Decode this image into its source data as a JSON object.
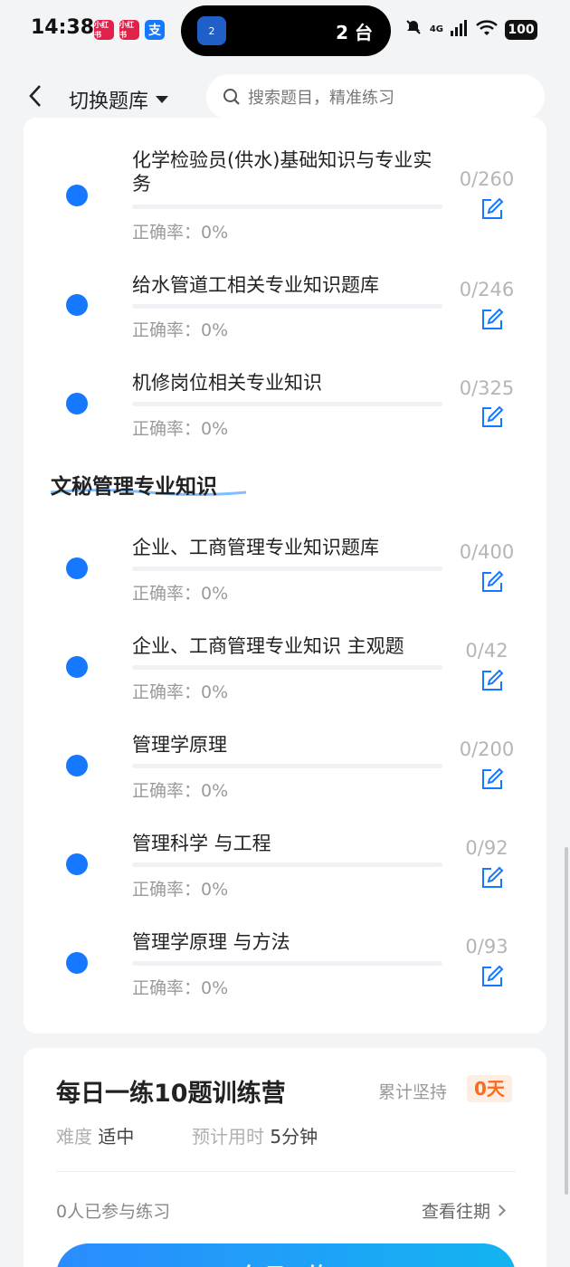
{
  "status_bar": {
    "time": "14:38",
    "app_badges": [
      "小红书",
      "小红书",
      "支"
    ],
    "island": {
      "icon_text": "2",
      "text": "2 台"
    },
    "network": "4G",
    "battery": "100"
  },
  "header": {
    "switch_label": "切换题库",
    "search_placeholder": "搜索题目，精准练习"
  },
  "bank_list": {
    "accuracy_prefix": "正确率：",
    "items_top": [
      {
        "title": "化学检验员(供水)基础知识与专业实务",
        "count": "0/260",
        "accuracy": "0%"
      },
      {
        "title": "给水管道工相关专业知识题库",
        "count": "0/246",
        "accuracy": "0%"
      },
      {
        "title": "机修岗位相关专业知识",
        "count": "0/325",
        "accuracy": "0%"
      }
    ],
    "section_title": "文秘管理专业知识",
    "items_section": [
      {
        "title": "企业、工商管理专业知识题库",
        "count": "0/400",
        "accuracy": "0%"
      },
      {
        "title": "企业、工商管理专业知识 主观题",
        "count": "0/42",
        "accuracy": "0%"
      },
      {
        "title": "管理学原理",
        "count": "0/200",
        "accuracy": "0%"
      },
      {
        "title": "管理科学 与工程",
        "count": "0/92",
        "accuracy": "0%"
      },
      {
        "title": "管理学原理 与方法",
        "count": "0/93",
        "accuracy": "0%"
      }
    ]
  },
  "daily": {
    "title": "每日一练10题训练营",
    "streak_label": "累计坚持",
    "streak_value": "0天",
    "difficulty_label": "难度",
    "difficulty_value": "适中",
    "time_label": "预计用时",
    "time_value": "5分钟",
    "participants": "0人已参与练习",
    "history_link": "查看往期",
    "start_button": "每日一练"
  },
  "colors": {
    "accent": "#1677ff",
    "streak": "#ff6a1a"
  }
}
